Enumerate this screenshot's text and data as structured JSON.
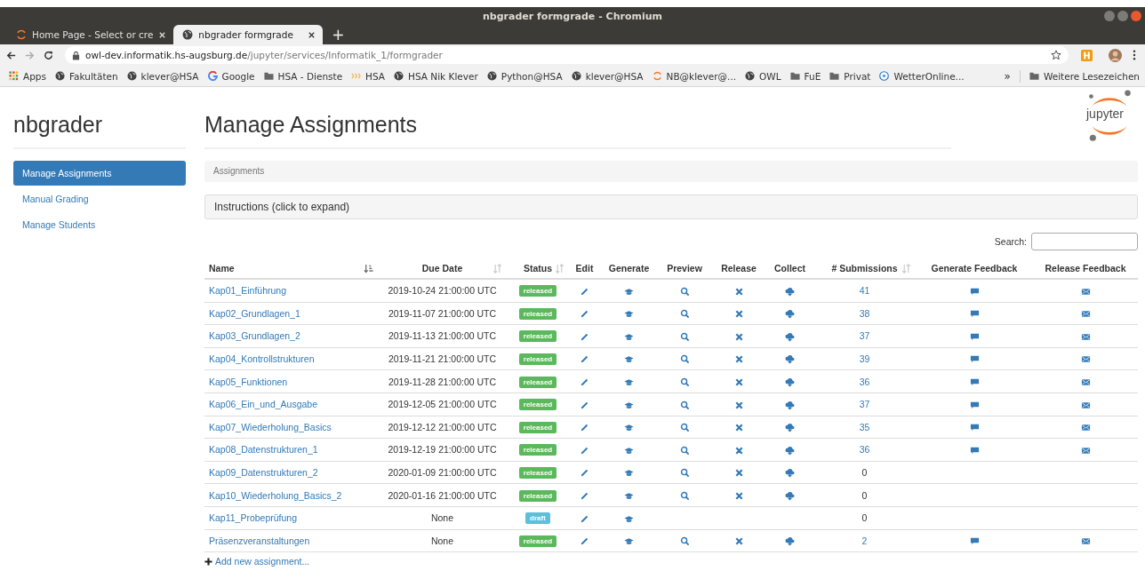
{
  "window": {
    "title": "nbgrader formgrade - Chromium"
  },
  "tabs": [
    {
      "label": "Home Page - Select or cre",
      "selected": false
    },
    {
      "label": "nbgrader formgrade",
      "selected": true
    }
  ],
  "new_tab": "+",
  "address": {
    "host": "owl-dev.informatik.hs-augsburg.de",
    "path": "/jupyter/services/Informatik_1/formgrader"
  },
  "bookmarks": [
    {
      "label": "Apps",
      "kind": "grid"
    },
    {
      "label": "Fakultäten",
      "kind": "globe"
    },
    {
      "label": "klever@HSA",
      "kind": "globe"
    },
    {
      "label": "Google",
      "kind": "google"
    },
    {
      "label": "HSA - Dienste",
      "kind": "folder"
    },
    {
      "label": "HSA",
      "kind": "wave"
    },
    {
      "label": "HSA Nik Klever",
      "kind": "globe"
    },
    {
      "label": "Python@HSA",
      "kind": "globe"
    },
    {
      "label": "klever@HSA",
      "kind": "globe"
    },
    {
      "label": "NB@klever@...",
      "kind": "arc"
    },
    {
      "label": "OWL",
      "kind": "globe"
    },
    {
      "label": "FuE",
      "kind": "folder"
    },
    {
      "label": "Privat",
      "kind": "folder"
    },
    {
      "label": "WetterOnline...",
      "kind": "weather"
    }
  ],
  "bookmarks_more": "»",
  "other_bookmarks": "Weitere Lesezeichen",
  "sidebar": {
    "title": "nbgrader",
    "items": [
      {
        "label": "Manage Assignments",
        "selected": true
      },
      {
        "label": "Manual Grading",
        "selected": false
      },
      {
        "label": "Manage Students",
        "selected": false
      }
    ]
  },
  "heading": "Manage Assignments",
  "logo": "jupyter",
  "breadcrumb": "Assignments",
  "instructions": "Instructions (click to expand)",
  "search": {
    "label": "Search:"
  },
  "table": {
    "columns": [
      {
        "label": "Name",
        "sortable": true,
        "sorted": true
      },
      {
        "label": "Due Date",
        "sortable": true,
        "sorted": false
      },
      {
        "label": "Status",
        "sortable": true,
        "sorted": false
      },
      {
        "label": "Edit",
        "sortable": false,
        "sorted": false
      },
      {
        "label": "Generate",
        "sortable": false,
        "sorted": false
      },
      {
        "label": "Preview",
        "sortable": false,
        "sorted": false
      },
      {
        "label": "Release",
        "sortable": false,
        "sorted": false
      },
      {
        "label": "Collect",
        "sortable": false,
        "sorted": false
      },
      {
        "label": "# Submissions",
        "sortable": true,
        "sorted": false
      },
      {
        "label": "Generate Feedback",
        "sortable": false,
        "sorted": false
      },
      {
        "label": "Release Feedback",
        "sortable": false,
        "sorted": false
      }
    ],
    "rows": [
      {
        "name": "Kap01_Einführung",
        "due": "2019-10-24 21:00:00 UTC",
        "status": "released",
        "kind": "released",
        "collect_actions": true,
        "feedback_actions": true,
        "submissions": "41",
        "submissions_link": true
      },
      {
        "name": "Kap02_Grundlagen_1",
        "due": "2019-11-07 21:00:00 UTC",
        "status": "released",
        "kind": "released",
        "collect_actions": true,
        "feedback_actions": true,
        "submissions": "38",
        "submissions_link": true
      },
      {
        "name": "Kap03_Grundlagen_2",
        "due": "2019-11-13 21:00:00 UTC",
        "status": "released",
        "kind": "released",
        "collect_actions": true,
        "feedback_actions": true,
        "submissions": "37",
        "submissions_link": true
      },
      {
        "name": "Kap04_Kontrollstrukturen",
        "due": "2019-11-21 21:00:00 UTC",
        "status": "released",
        "kind": "released",
        "collect_actions": true,
        "feedback_actions": true,
        "submissions": "39",
        "submissions_link": true
      },
      {
        "name": "Kap05_Funktionen",
        "due": "2019-11-28 21:00:00 UTC",
        "status": "released",
        "kind": "released",
        "collect_actions": true,
        "feedback_actions": true,
        "submissions": "36",
        "submissions_link": true
      },
      {
        "name": "Kap06_Ein_und_Ausgabe",
        "due": "2019-12-05 21:00:00 UTC",
        "status": "released",
        "kind": "released",
        "collect_actions": true,
        "feedback_actions": true,
        "submissions": "37",
        "submissions_link": true
      },
      {
        "name": "Kap07_Wiederholung_Basics",
        "due": "2019-12-12 21:00:00 UTC",
        "status": "released",
        "kind": "released",
        "collect_actions": true,
        "feedback_actions": true,
        "submissions": "35",
        "submissions_link": true
      },
      {
        "name": "Kap08_Datenstrukturen_1",
        "due": "2019-12-19 21:00:00 UTC",
        "status": "released",
        "kind": "released",
        "collect_actions": true,
        "feedback_actions": true,
        "submissions": "36",
        "submissions_link": true
      },
      {
        "name": "Kap09_Datenstrukturen_2",
        "due": "2020-01-09 21:00:00 UTC",
        "status": "released",
        "kind": "released",
        "collect_actions": true,
        "feedback_actions": false,
        "submissions": "0",
        "submissions_link": false
      },
      {
        "name": "Kap10_Wiederholung_Basics_2",
        "due": "2020-01-16 21:00:00 UTC",
        "status": "released",
        "kind": "released",
        "collect_actions": true,
        "feedback_actions": false,
        "submissions": "0",
        "submissions_link": false
      },
      {
        "name": "Kap11_Probeprüfung",
        "due": "None",
        "status": "draft",
        "kind": "draft",
        "collect_actions": false,
        "feedback_actions": false,
        "submissions": "0",
        "submissions_link": false
      },
      {
        "name": "Präsenzveranstaltungen",
        "due": "None",
        "status": "released",
        "kind": "released",
        "collect_actions": true,
        "feedback_actions": true,
        "submissions": "2",
        "submissions_link": true
      }
    ]
  },
  "add_link": "Add new assignment..."
}
